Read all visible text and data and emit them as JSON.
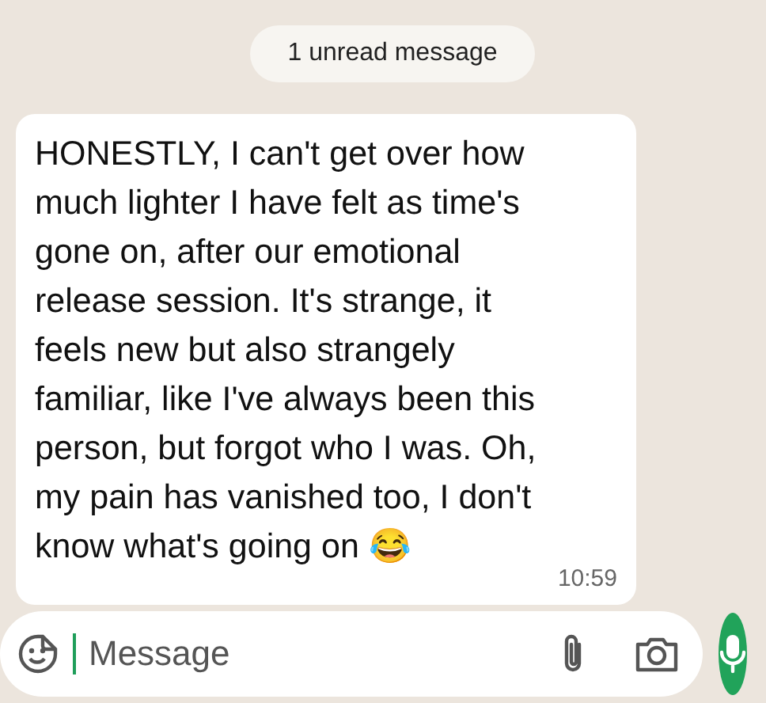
{
  "unread_banner": "1 unread message",
  "message": {
    "text": "HONESTLY, I can't get over how much lighter I have felt as time's gone on, after our emotional release session. It's strange, it feels new but also strangely familiar, like I've always been this person, but forgot who I was. Oh, my pain has vanished too, I don't know what's going on 😂",
    "time": "10:59"
  },
  "composer": {
    "placeholder": "Message"
  }
}
